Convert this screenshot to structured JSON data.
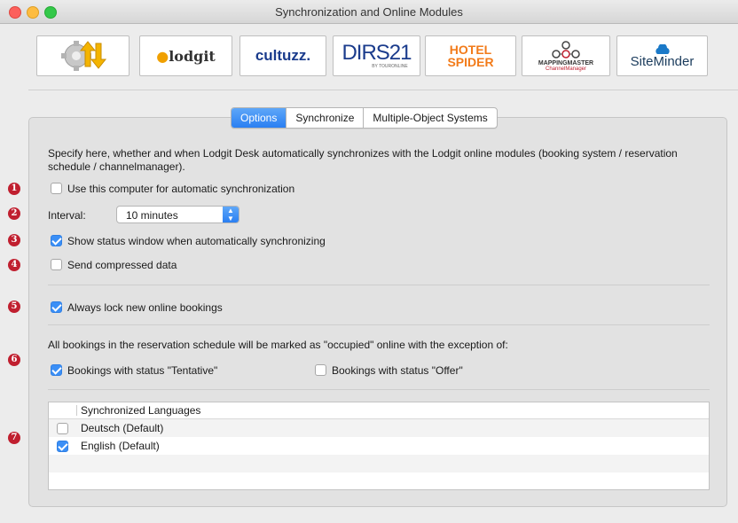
{
  "window": {
    "title": "Synchronization and Online Modules"
  },
  "toolbar": {
    "modules": [
      {
        "name": "sync-settings",
        "label": ""
      },
      {
        "name": "lodgit",
        "label": "lodgit"
      },
      {
        "name": "cultuzz",
        "label": "cultuzz."
      },
      {
        "name": "dirs21",
        "label": "DIRS21",
        "sub": "BY TOURONLINE"
      },
      {
        "name": "hotelspider",
        "label": "HOTEL SPIDER"
      },
      {
        "name": "mappingmaster",
        "label": "MAPPINGMASTER",
        "sub": "ChannelManager"
      },
      {
        "name": "siteminder",
        "label": "SiteMinder"
      }
    ]
  },
  "tabs": {
    "options": "Options",
    "synchronize": "Synchronize",
    "multi": "Multiple-Object Systems"
  },
  "intro": "Specify here, whether and when Lodgit Desk automatically synchronizes with the Lodgit online modules (booking system / reservation schedule / channelmanager).",
  "options": {
    "auto_sync": {
      "label": "Use this computer for automatic synchronization",
      "checked": false,
      "num": "1"
    },
    "interval": {
      "label": "Interval:",
      "value": "10 minutes",
      "num": "2"
    },
    "status_window": {
      "label": "Show status window when automatically synchronizing",
      "checked": true,
      "num": "3"
    },
    "compressed": {
      "label": "Send compressed data",
      "checked": false,
      "num": "4"
    },
    "lock_bookings": {
      "label": "Always lock new online bookings",
      "checked": true,
      "num": "5"
    },
    "occupied_text": "All bookings in the reservation schedule will be marked as \"occupied\" online with the exception of:",
    "tentative": {
      "label": "Bookings with status \"Tentative\"",
      "checked": true,
      "num": "6"
    },
    "offer": {
      "label": "Bookings with status \"Offer\"",
      "checked": false
    }
  },
  "languages": {
    "num": "7",
    "header": "Synchronized Languages",
    "rows": [
      {
        "label": "Deutsch (Default)",
        "checked": false
      },
      {
        "label": "English (Default)",
        "checked": true
      }
    ]
  },
  "colors": {
    "accent": "#2a7ff2",
    "badge": "#c01f2f"
  }
}
